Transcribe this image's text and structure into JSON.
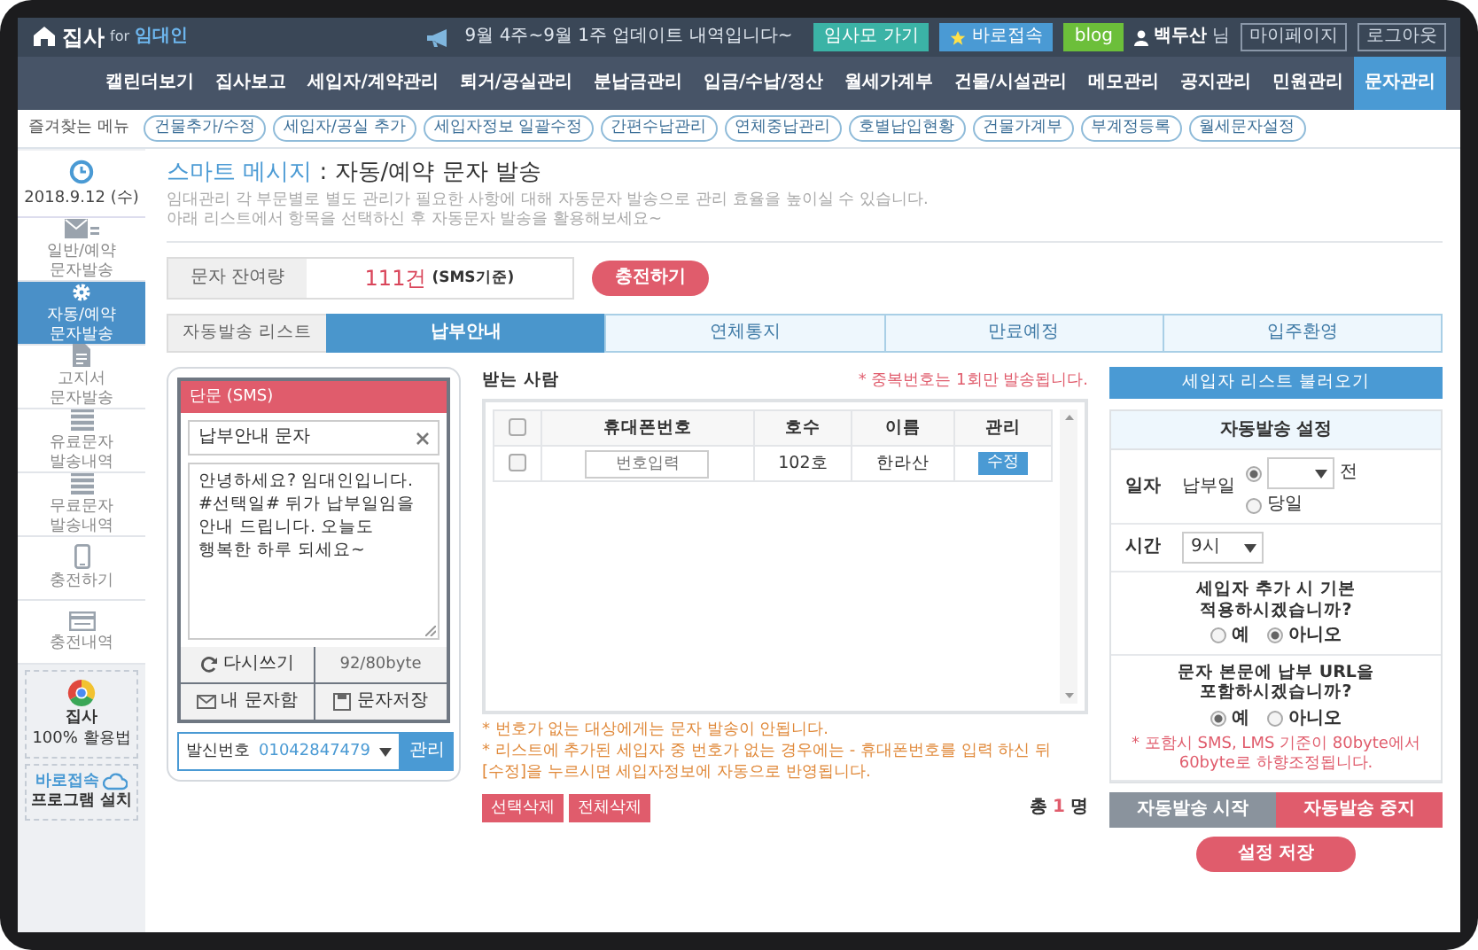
{
  "header": {
    "logo": {
      "name": "집사",
      "connector": "for",
      "sub": "임대인"
    },
    "notice": "9월 4주~9월 1주 업데이트 내역입니다~",
    "links": [
      {
        "label": "임사모 가기",
        "color": "#3bb3a6",
        "kind": "plain"
      },
      {
        "label": "바로접속",
        "color": "#4a9ad4",
        "kind": "star"
      },
      {
        "label": "blog",
        "color": "#6cbf3a",
        "kind": "plain"
      }
    ],
    "account": {
      "user": "백두산",
      "suffix": "님",
      "buttons": [
        "마이페이지",
        "로그아웃"
      ]
    }
  },
  "nav": [
    {
      "label": "캘린더보기",
      "selected": false
    },
    {
      "label": "집사보고",
      "selected": false
    },
    {
      "label": "세입자/계약관리",
      "selected": false
    },
    {
      "label": "퇴거/공실관리",
      "selected": false
    },
    {
      "label": "분납금관리",
      "selected": false
    },
    {
      "label": "입금/수납/정산",
      "selected": false
    },
    {
      "label": "월세가계부",
      "selected": false
    },
    {
      "label": "건물/시설관리",
      "selected": false
    },
    {
      "label": "메모관리",
      "selected": false
    },
    {
      "label": "공지관리",
      "selected": false
    },
    {
      "label": "민원관리",
      "selected": false
    },
    {
      "label": "문자관리",
      "selected": true
    }
  ],
  "favorites": {
    "label": "즐겨찾는 메뉴",
    "items": [
      "건물추가/수정",
      "세입자/공실 추가",
      "세입자정보 일괄수정",
      "간편수납관리",
      "연체중납관리",
      "호별납입현황",
      "건물가계부",
      "부계정등록",
      "월세문자설정"
    ]
  },
  "sidebar": {
    "date": "2018.9.12 (수)",
    "items": [
      {
        "label": "일반/예약 문자발송",
        "selected": false
      },
      {
        "label": "자동/예약 문자발송",
        "selected": true
      },
      {
        "label": "고지서 문자발송",
        "selected": false
      },
      {
        "label": "유료문자 발송내역",
        "selected": false
      },
      {
        "label": "무료문자 발송내역",
        "selected": false
      },
      {
        "label": "충전하기",
        "selected": false
      },
      {
        "label": "충전내역",
        "selected": false
      }
    ],
    "promos": [
      {
        "kind": "guide",
        "title": "집사",
        "sub": "100% 활용법"
      },
      {
        "kind": "install",
        "title": "바로접속",
        "sub": "프로그램 설치"
      }
    ]
  },
  "page": {
    "title_accent": "스마트 메시지",
    "title": " : 자동/예약 문자 발송",
    "description": [
      "임대관리 각 부문별로 별도 관리가 필요한 사항에 대해 자동문자 발송으로 관리 효율을 높이실 수 있습니다.",
      "아래 리스트에서 항목을 선택하신 후 자동문자 발송을 활용해보세요~"
    ],
    "balance": {
      "label": "문자 잔여량",
      "value": "111건",
      "unit": "(SMS기준)",
      "button": "충전하기"
    },
    "list_label": "자동발송 리스트",
    "tabs": [
      {
        "label": "납부안내",
        "selected": true
      },
      {
        "label": "연체통지",
        "selected": false
      },
      {
        "label": "만료예정",
        "selected": false
      },
      {
        "label": "입주환영",
        "selected": false
      }
    ]
  },
  "message": {
    "type": "단문 (SMS)",
    "subject": "납부안내 문자",
    "body": "안녕하세요? 임대인입니다. #선택일# 뒤가 납부일임을 안내 드립니다. 오늘도 행복한 하루 되세요~",
    "rewrite": "다시쓰기",
    "bytes": "92/80byte",
    "inbox": "내 문자함",
    "save": "문자저장",
    "sender": {
      "label": "발신번호",
      "value": "01042847479",
      "button": "관리"
    }
  },
  "recipients": {
    "title": "받는 사람",
    "notice": "* 중복번호는 1회만 발송됩니다.",
    "select_all_checked": false,
    "columns": [
      "휴대폰번호",
      "호수",
      "이름",
      "관리"
    ],
    "rows": [
      {
        "checked": false,
        "phone": {
          "placeholder": "번호입력"
        },
        "unit": "102호",
        "name": "한라산",
        "action": "수정"
      }
    ],
    "notes": [
      "* 번호가 없는 대상에게는 문자 발송이 안됩니다.",
      "* 리스트에 추가된 세입자 중 번호가 없는 경우에는 - 휴대폰번호를 입력 하신 뒤 [수정]을 누르시면 세입자정보에 자동으로 반영됩니다."
    ],
    "buttons": [
      "선택삭제",
      "전체삭제"
    ],
    "total": {
      "prefix": "총",
      "count": "1",
      "suffix": "명"
    }
  },
  "settings": {
    "load_button": "세입자 리스트 불러오기",
    "title": "자동발송 설정",
    "date": {
      "label": "일자",
      "base": "납부일",
      "options": [
        {
          "kind": "offset",
          "selected": true,
          "suffix": "전"
        },
        {
          "kind": "label",
          "selected": false,
          "label": "당일"
        }
      ]
    },
    "time": {
      "label": "시간",
      "value": "9시"
    },
    "questions": [
      {
        "text": "세입자 추가 시 기본 적용하시겠습니까?",
        "options": [
          {
            "label": "예",
            "selected": false
          },
          {
            "label": "아니오",
            "selected": true
          }
        ]
      },
      {
        "text": "문자 본문에 납부 URL을 포함하시겠습니까?",
        "options": [
          {
            "label": "예",
            "selected": true
          },
          {
            "label": "아니오",
            "selected": false
          }
        ],
        "note": "* 포함시 SMS, LMS 기준이 80byte에서 60byte로 하향조정됩니다."
      }
    ],
    "actions": [
      {
        "label": "자동발송 시작",
        "kind": "secondary"
      },
      {
        "label": "자동발송 중지",
        "kind": "danger"
      }
    ],
    "save_button": "설정 저장"
  }
}
